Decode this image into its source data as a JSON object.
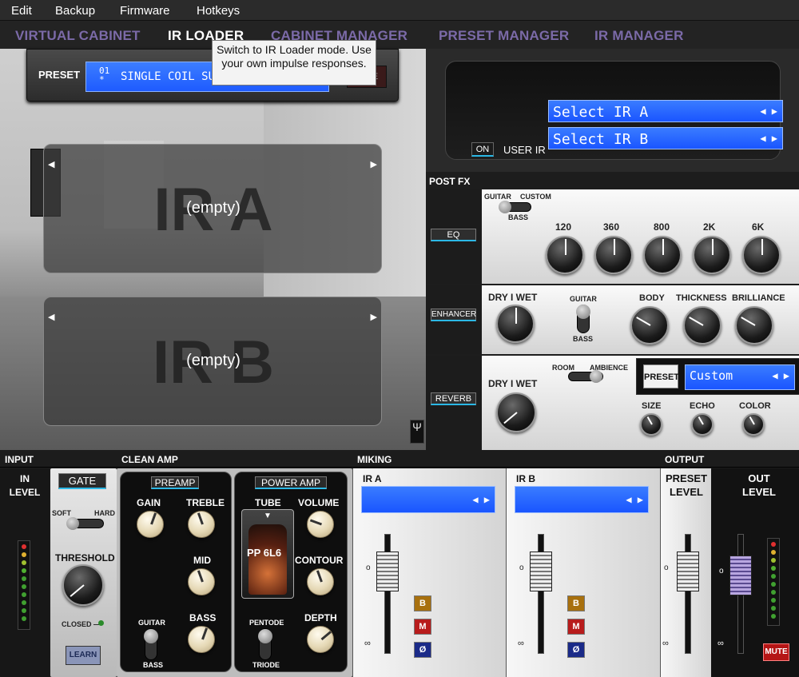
{
  "menu": [
    "Edit",
    "Backup",
    "Firmware",
    "Hotkeys"
  ],
  "tabs": [
    "VIRTUAL CABINET",
    "IR LOADER",
    "CABINET MANAGER",
    "PRESET MANAGER",
    "IR MANAGER"
  ],
  "active_tab": "IR LOADER",
  "tooltip": "Switch to IR Loader mode. Use your own impulse responses.",
  "preset": {
    "label": "PRESET",
    "number": "01",
    "marker": "*",
    "name": "SINGLE COIL SUMMER HE...",
    "save": "SAVE"
  },
  "ir_slots": [
    {
      "big": "IR A",
      "value": "(empty)"
    },
    {
      "big": "IR B",
      "value": "(empty)"
    }
  ],
  "user_ir": {
    "on": "ON",
    "label": "USER IR",
    "select_a": "Select IR A",
    "select_b": "Select IR B",
    "arrows": "◀ ▶"
  },
  "postfx": {
    "title": "POST FX",
    "eq": {
      "button": "EQ",
      "mode_left": "GUITAR",
      "mode_right": "CUSTOM",
      "mode_bottom": "BASS",
      "bands": [
        "120",
        "360",
        "800",
        "2K",
        "6K"
      ]
    },
    "enhancer": {
      "button": "ENHANCER",
      "drywet": "DRY I WET",
      "toggle_top": "GUITAR",
      "toggle_bottom": "BASS",
      "knobs": [
        "BODY",
        "THICKNESS",
        "BRILLIANCE"
      ]
    },
    "reverb": {
      "button": "REVERB",
      "drywet": "DRY I WET",
      "mode_left": "ROOM",
      "mode_right": "AMBIENCE",
      "preset_btn": "PRESET",
      "preset_value": "Custom",
      "knobs": [
        "SIZE",
        "ECHO",
        "COLOR"
      ]
    }
  },
  "input": {
    "title": "INPUT",
    "level": "IN LEVEL",
    "gate": "GATE",
    "soft": "SOFT",
    "hard": "HARD",
    "threshold": "THRESHOLD",
    "closed": "CLOSED —",
    "learn": "LEARN"
  },
  "amp": {
    "title": "CLEAN AMP",
    "preamp": {
      "title": "PREAMP",
      "gain": "GAIN",
      "treble": "TREBLE",
      "mid": "MID",
      "bass": "BASS",
      "toggle_top": "GUITAR",
      "toggle_bottom": "BASS"
    },
    "power": {
      "title": "POWER AMP",
      "tube": "TUBE",
      "tube_name": "PP 6L6",
      "volume": "VOLUME",
      "contour": "CONTOUR",
      "depth": "DEPTH",
      "toggle_top": "PENTODE",
      "toggle_bottom": "TRIODE"
    }
  },
  "miking": {
    "title": "MIKING",
    "channels": [
      {
        "label": "IR A"
      },
      {
        "label": "IR B"
      }
    ],
    "buttons": [
      "B",
      "M",
      "Ø"
    ],
    "arrows": "◀ ▶"
  },
  "output": {
    "title": "OUTPUT",
    "preset_level": "PRESET LEVEL",
    "out_level": "OUT LEVEL",
    "mute": "MUTE"
  },
  "tuner_icon": "tuning-fork-icon"
}
